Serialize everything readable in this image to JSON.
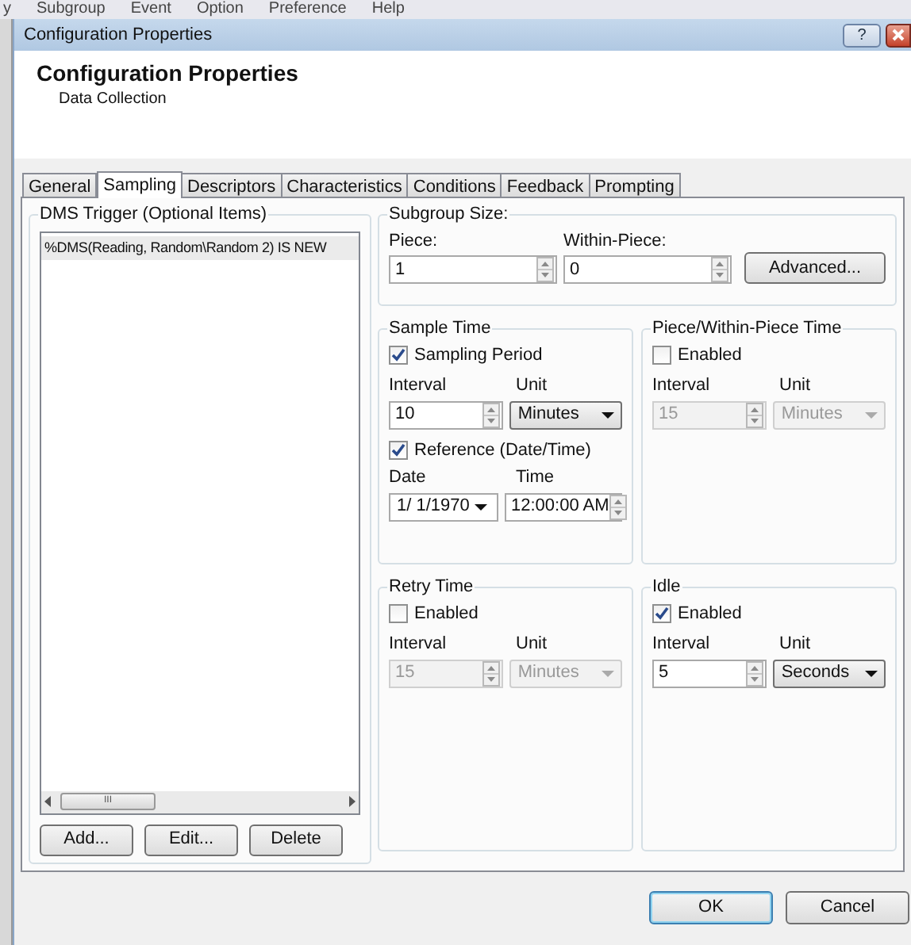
{
  "app_menu": [
    "y",
    "Subgroup",
    "Event",
    "Option",
    "Preference",
    "Help"
  ],
  "window": {
    "title": "Configuration Properties",
    "help_button": "?"
  },
  "header": {
    "title": "Configuration Properties",
    "subtitle": "Data Collection"
  },
  "tabs": [
    {
      "label": "General",
      "selected": false
    },
    {
      "label": "Sampling",
      "selected": true
    },
    {
      "label": "Descriptors",
      "selected": false
    },
    {
      "label": "Characteristics",
      "selected": false
    },
    {
      "label": "Conditions",
      "selected": false
    },
    {
      "label": "Feedback",
      "selected": false
    },
    {
      "label": "Prompting",
      "selected": false
    }
  ],
  "trigger_group": {
    "title": "DMS Trigger (Optional Items)",
    "items": [
      {
        "text": "%DMS(Reading, Random\\Random 2) IS NEW",
        "selected": true
      }
    ],
    "scroll_grip": "III",
    "buttons": [
      "Add...",
      "Edit...",
      "Delete"
    ]
  },
  "subgroup_size": {
    "title": "Subgroup Size:",
    "fields": [
      {
        "label": "Piece:",
        "value": "1"
      },
      {
        "label": "Within-Piece:",
        "value": "0"
      }
    ],
    "button": "Advanced..."
  },
  "sample_time": {
    "title": "Sample Time",
    "sampling_period": {
      "label": "Sampling Period",
      "checked": true
    },
    "interval_label": "Interval",
    "interval": "10",
    "unit_label": "Unit",
    "unit": "Minutes",
    "reference": {
      "label": "Reference (Date/Time)",
      "checked": true
    },
    "date_label": "Date",
    "date": "1/ 1/1970",
    "time_label": "Time",
    "time": "12:00:00 AM"
  },
  "piece_time": {
    "title": "Piece/Within-Piece Time",
    "enabled": {
      "label": "Enabled",
      "checked": false
    },
    "interval_label": "Interval",
    "interval": "15",
    "unit_label": "Unit",
    "unit": "Minutes"
  },
  "retry_time": {
    "title": "Retry Time",
    "enabled": {
      "label": "Enabled",
      "checked": false
    },
    "interval_label": "Interval",
    "interval": "15",
    "unit_label": "Unit",
    "unit": "Minutes"
  },
  "idle": {
    "title": "Idle",
    "enabled": {
      "label": "Enabled",
      "checked": true
    },
    "interval_label": "Interval",
    "interval": "5",
    "unit_label": "Unit",
    "unit": "Seconds"
  },
  "buttons": [
    {
      "label": "OK",
      "default": true
    },
    {
      "label": "Cancel",
      "default": false
    }
  ]
}
